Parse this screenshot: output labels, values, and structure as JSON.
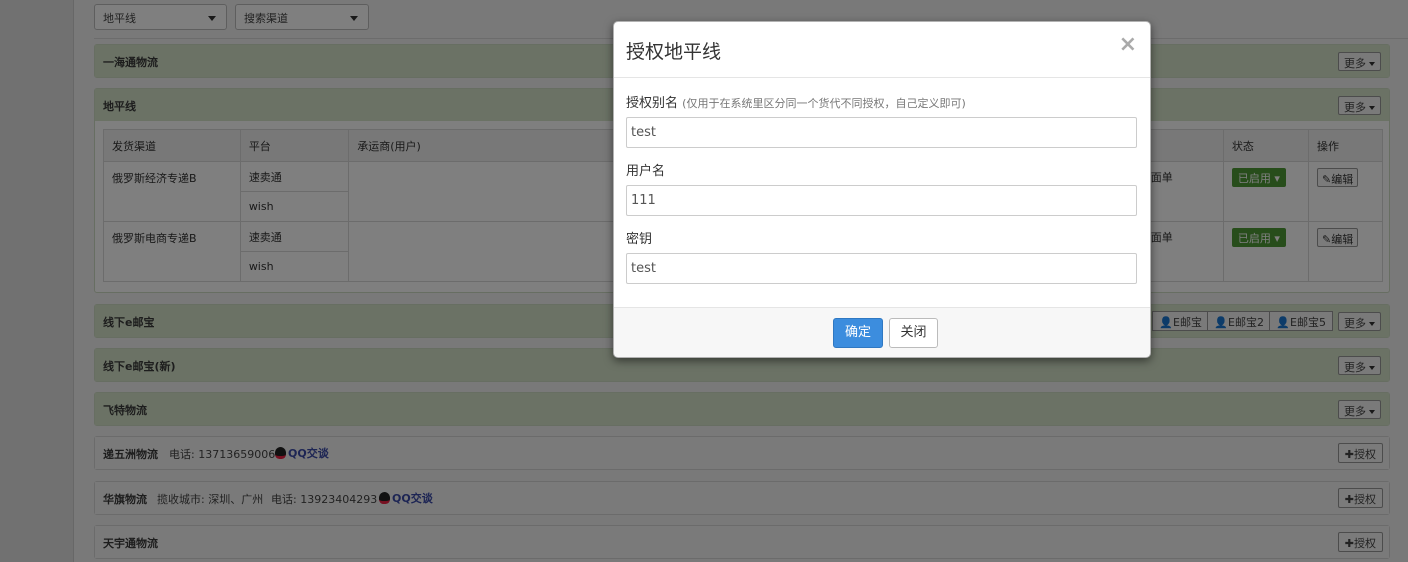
{
  "filters": {
    "carrier_select": "地平线",
    "channel_select": "搜索渠道"
  },
  "panels": [
    {
      "title": "一海通物流",
      "more": "更多"
    },
    {
      "title": "地平线",
      "more": "更多"
    },
    {
      "title": "线下e邮宝",
      "more": "更多",
      "buttons": [
        "E邮宝",
        "E邮宝2",
        "E邮宝5"
      ]
    },
    {
      "title": "线下e邮宝(新)",
      "more": "更多"
    },
    {
      "title": "飞特物流",
      "more": "更多"
    },
    {
      "title": "递五洲物流",
      "phone": "电话: 13713659006",
      "qq": "QQ交谈",
      "auth": "授权"
    },
    {
      "title": "华旗物流",
      "city": "揽收城市: 深圳、广州",
      "phone": "电话: 13923404293",
      "qq": "QQ交谈",
      "auth": "授权"
    },
    {
      "title": "天宇通物流",
      "auth": "授权"
    }
  ],
  "table": {
    "headers": [
      "发货渠道",
      "平台",
      "承运商(用户)",
      "",
      "状态",
      "操作"
    ],
    "rows": [
      {
        "channel": "俄罗斯经济专递B",
        "platforms": [
          "速卖通",
          "wish"
        ],
        "side_text": "面单",
        "status": "已启用",
        "action": "编辑"
      },
      {
        "channel": "俄罗斯电商专递B",
        "platforms": [
          "速卖通",
          "wish"
        ],
        "side_text": "面单",
        "status": "已启用",
        "action": "编辑"
      }
    ]
  },
  "modal": {
    "title": "授权地平线",
    "close": "×",
    "fields": [
      {
        "label": "授权别名",
        "hint": "(仅用于在系统里区分同一个货代不同授权，自己定义即可)",
        "value": "test"
      },
      {
        "label": "用户名",
        "value": "111"
      },
      {
        "label": "密钥",
        "value": "test"
      }
    ],
    "confirm": "确定",
    "cancel": "关闭"
  }
}
